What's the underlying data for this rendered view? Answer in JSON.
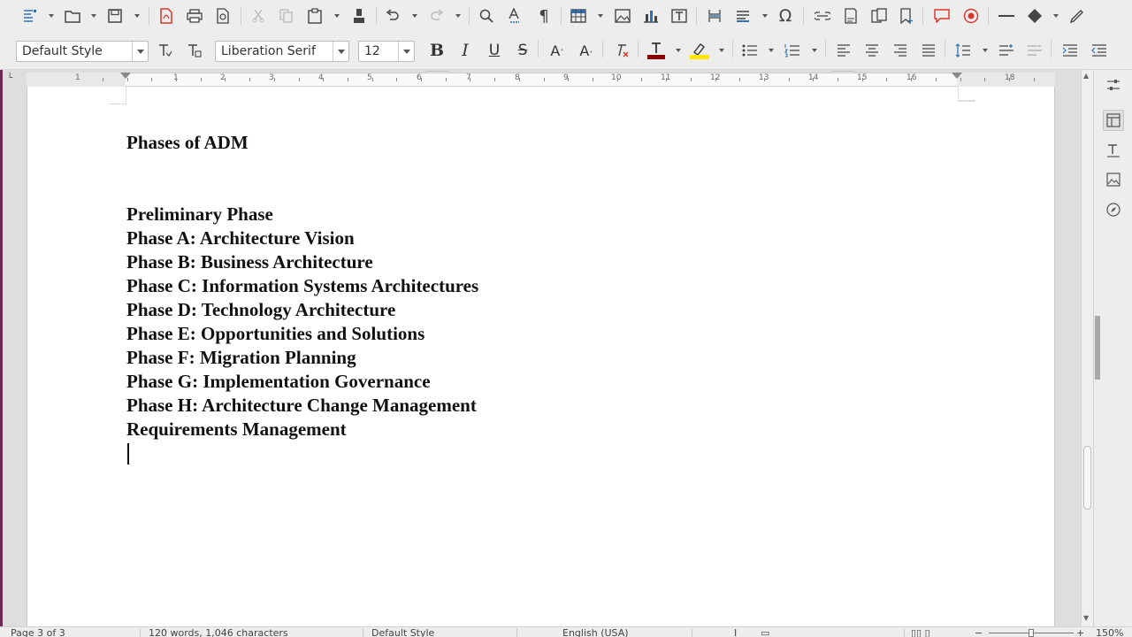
{
  "toolbar": {
    "paragraph_style": "Default Style",
    "font_name": "Liberation Serif",
    "font_size": "12"
  },
  "document": {
    "heading": "Phases of ADM",
    "items": [
      "Preliminary Phase",
      "Phase A: Architecture Vision",
      "Phase B: Business Architecture",
      "Phase C: Information Systems Architectures",
      "Phase D: Technology Architecture",
      "Phase E: Opportunities and Solutions",
      "Phase F: Migration Planning",
      "Phase G: Implementation Governance",
      "Phase H: Architecture Change Management",
      "Requirements Management"
    ]
  },
  "ruler": {
    "labels": [
      "1",
      "1",
      "2",
      "3",
      "4",
      "5",
      "6",
      "7",
      "8",
      "9",
      "10",
      "11",
      "12",
      "13",
      "14",
      "15",
      "16",
      "18"
    ]
  },
  "status": {
    "page": "Page 3 of 3",
    "words": "120 words, 1,046 characters",
    "style": "Default Style",
    "language": "English (USA)",
    "zoom": "150%"
  },
  "colors": {
    "font_color": "#8b0000",
    "highlight_color": "#ffe600",
    "accent_red": "#d9362b"
  }
}
